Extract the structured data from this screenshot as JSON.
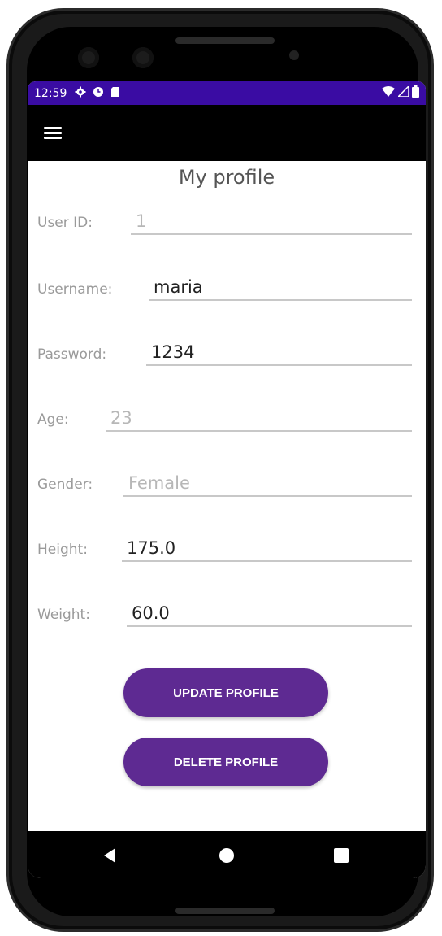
{
  "statusbar": {
    "time": "12:59",
    "icons_left": [
      "settings-icon",
      "alarm-icon",
      "sdcard-icon"
    ],
    "icons_right": [
      "wifi-icon",
      "signal-icon",
      "battery-icon"
    ],
    "color": "#3a0ca3"
  },
  "appbar": {
    "color": "#000000",
    "menu_icon": "hamburger-menu-icon"
  },
  "page": {
    "title": "My profile"
  },
  "form": {
    "user_id": {
      "label": "User ID:",
      "value": "1"
    },
    "username": {
      "label": "Username:",
      "value": "maria"
    },
    "password": {
      "label": "Password:",
      "value": "1234"
    },
    "age": {
      "label": "Age:",
      "value": "23"
    },
    "gender": {
      "label": "Gender:",
      "value": "Female"
    },
    "height": {
      "label": "Height:",
      "value": "175.0"
    },
    "weight": {
      "label": "Weight:",
      "value": "60.0"
    }
  },
  "buttons": {
    "update": "UPDATE PROFILE",
    "delete": "DELETE PROFILE",
    "color": "#5e2a92"
  },
  "navbar": {
    "icons": [
      "back-icon",
      "home-icon",
      "recents-icon"
    ]
  }
}
